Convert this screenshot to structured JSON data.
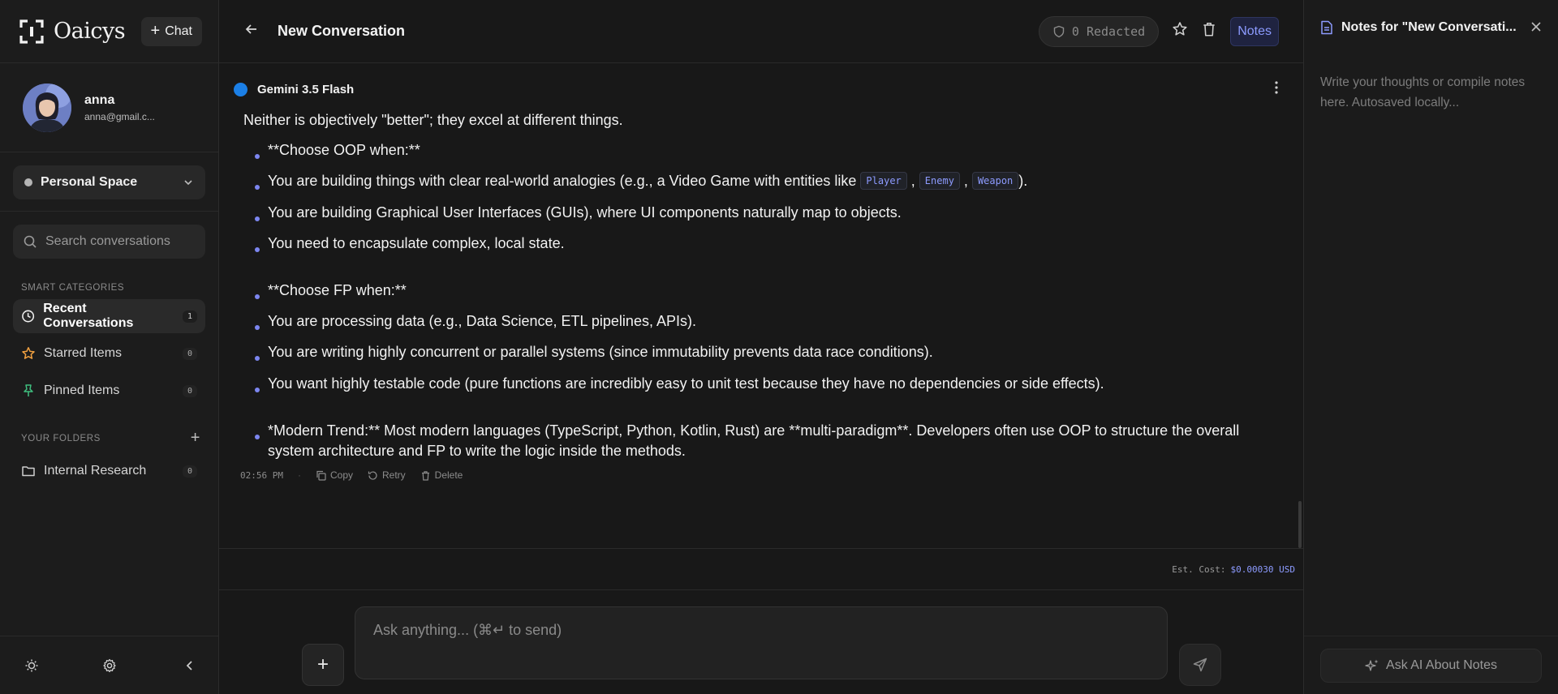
{
  "brand": {
    "name": "Oaicys",
    "chat_button": "Chat"
  },
  "user": {
    "name": "anna",
    "email": "anna@gmail.c..."
  },
  "space": {
    "label": "Personal Space"
  },
  "search": {
    "placeholder": "Search conversations"
  },
  "smart_categories": {
    "label": "SMART CATEGORIES",
    "items": [
      {
        "label": "Recent Conversations",
        "count": "1",
        "icon": "clock-icon"
      },
      {
        "label": "Starred Items",
        "count": "0",
        "icon": "star-icon",
        "color": "#f0a040"
      },
      {
        "label": "Pinned Items",
        "count": "0",
        "icon": "pin-icon",
        "color": "#3fbf7f"
      }
    ]
  },
  "folders": {
    "label": "YOUR FOLDERS",
    "items": [
      {
        "label": "Internal Research",
        "count": "0",
        "icon": "folder-icon"
      }
    ]
  },
  "header": {
    "title": "New Conversation",
    "redacted": "0 Redacted",
    "notes_tab": "Notes"
  },
  "model": {
    "name": "Gemini 3.5 Flash",
    "color": "#1b7fe6"
  },
  "message": {
    "intro": "Neither is objectively \"better\"; they excel at different things.",
    "oop_heading": "**Choose OOP when:**",
    "oop_1_prefix": "You are building things with clear real-world analogies (e.g., a Video Game with entities like",
    "code_player": "Player",
    "code_enemy": "Enemy",
    "code_weapon": "Weapon",
    "oop_1_suffix": ").",
    "oop_2": "You are building Graphical User Interfaces (GUIs), where UI components naturally map to objects.",
    "oop_3": "You need to encapsulate complex, local state.",
    "fp_heading": "**Choose FP when:**",
    "fp_1": "You are processing data (e.g., Data Science, ETL pipelines, APIs).",
    "fp_2": "You are writing highly concurrent or parallel systems (since immutability prevents data race conditions).",
    "fp_3": "You want highly testable code (pure functions are incredibly easy to unit test because they have no dependencies or side effects).",
    "trend": "*Modern Trend:** Most modern languages (TypeScript, Python, Kotlin, Rust) are **multi-paradigm**. Developers often use OOP to structure the overall system architecture and FP to write the logic inside the methods.",
    "time": "02:56 PM",
    "copy": "Copy",
    "retry": "Retry",
    "delete": "Delete"
  },
  "cost": {
    "label": "Est. Cost:",
    "value": "$0.00030 USD"
  },
  "composer": {
    "placeholder": "Ask anything... (⌘↵ to send)"
  },
  "notes_panel": {
    "title": "Notes for \"New Conversati...",
    "placeholder": "Write your thoughts or compile notes here. Autosaved locally...",
    "ask_ai": "Ask AI About Notes"
  },
  "colors": {
    "accent": "#8d9bff",
    "background": "#181818"
  }
}
